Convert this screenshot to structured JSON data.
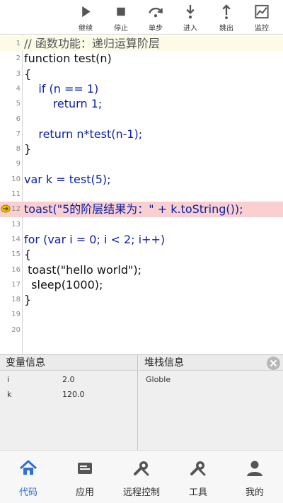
{
  "toolbar": {
    "continue_label": "继续",
    "stop_label": "停止",
    "step_over_label": "单步",
    "step_into_label": "进入",
    "step_out_label": "跳出",
    "monitor_label": "监控"
  },
  "editor": {
    "lines": [
      {
        "n": "1",
        "text": "// 函数功能：递归运算阶层"
      },
      {
        "n": "2",
        "text": "function test(n)"
      },
      {
        "n": "3",
        "text": "{"
      },
      {
        "n": "4",
        "text": "    if (n == 1)"
      },
      {
        "n": "5",
        "text": "        return 1;"
      },
      {
        "n": "6",
        "text": ""
      },
      {
        "n": "7",
        "text": "    return n*test(n-1);"
      },
      {
        "n": "8",
        "text": "}"
      },
      {
        "n": "9",
        "text": ""
      },
      {
        "n": "10",
        "text": "var k = test(5);"
      },
      {
        "n": "11",
        "text": ""
      },
      {
        "n": "12",
        "text": "toast(\"5的阶层结果为：\" + k.toString());"
      },
      {
        "n": "13",
        "text": ""
      },
      {
        "n": "14",
        "text": "for (var i = 0; i < 2; i++)"
      },
      {
        "n": "15",
        "text": "{"
      },
      {
        "n": "16",
        "text": " toast(\"hello world\");"
      },
      {
        "n": "17",
        "text": "  sleep(1000);"
      },
      {
        "n": "18",
        "text": "}"
      },
      {
        "n": "19",
        "text": ""
      },
      {
        "n": "20",
        "text": ""
      }
    ],
    "current_line": "12"
  },
  "variables_panel": {
    "title": "变量信息",
    "rows": [
      {
        "name": "i",
        "value": "2.0"
      },
      {
        "name": "k",
        "value": "120.0"
      }
    ]
  },
  "stack_panel": {
    "title": "堆栈信息",
    "rows": [
      "Globle"
    ]
  },
  "bottom_nav": {
    "items": [
      {
        "label": "代码",
        "icon": "home-icon",
        "active": true
      },
      {
        "label": "应用",
        "icon": "app-icon",
        "active": false
      },
      {
        "label": "远程控制",
        "icon": "remote-control-icon",
        "active": false
      },
      {
        "label": "工具",
        "icon": "tools-icon",
        "active": false
      },
      {
        "label": "我的",
        "icon": "user-icon",
        "active": false
      }
    ]
  },
  "colors": {
    "accent": "#2f6fd6",
    "keyword": "#0b1ea7",
    "string": "#1c7a2a",
    "current_line_bg": "#f9cfcf"
  }
}
